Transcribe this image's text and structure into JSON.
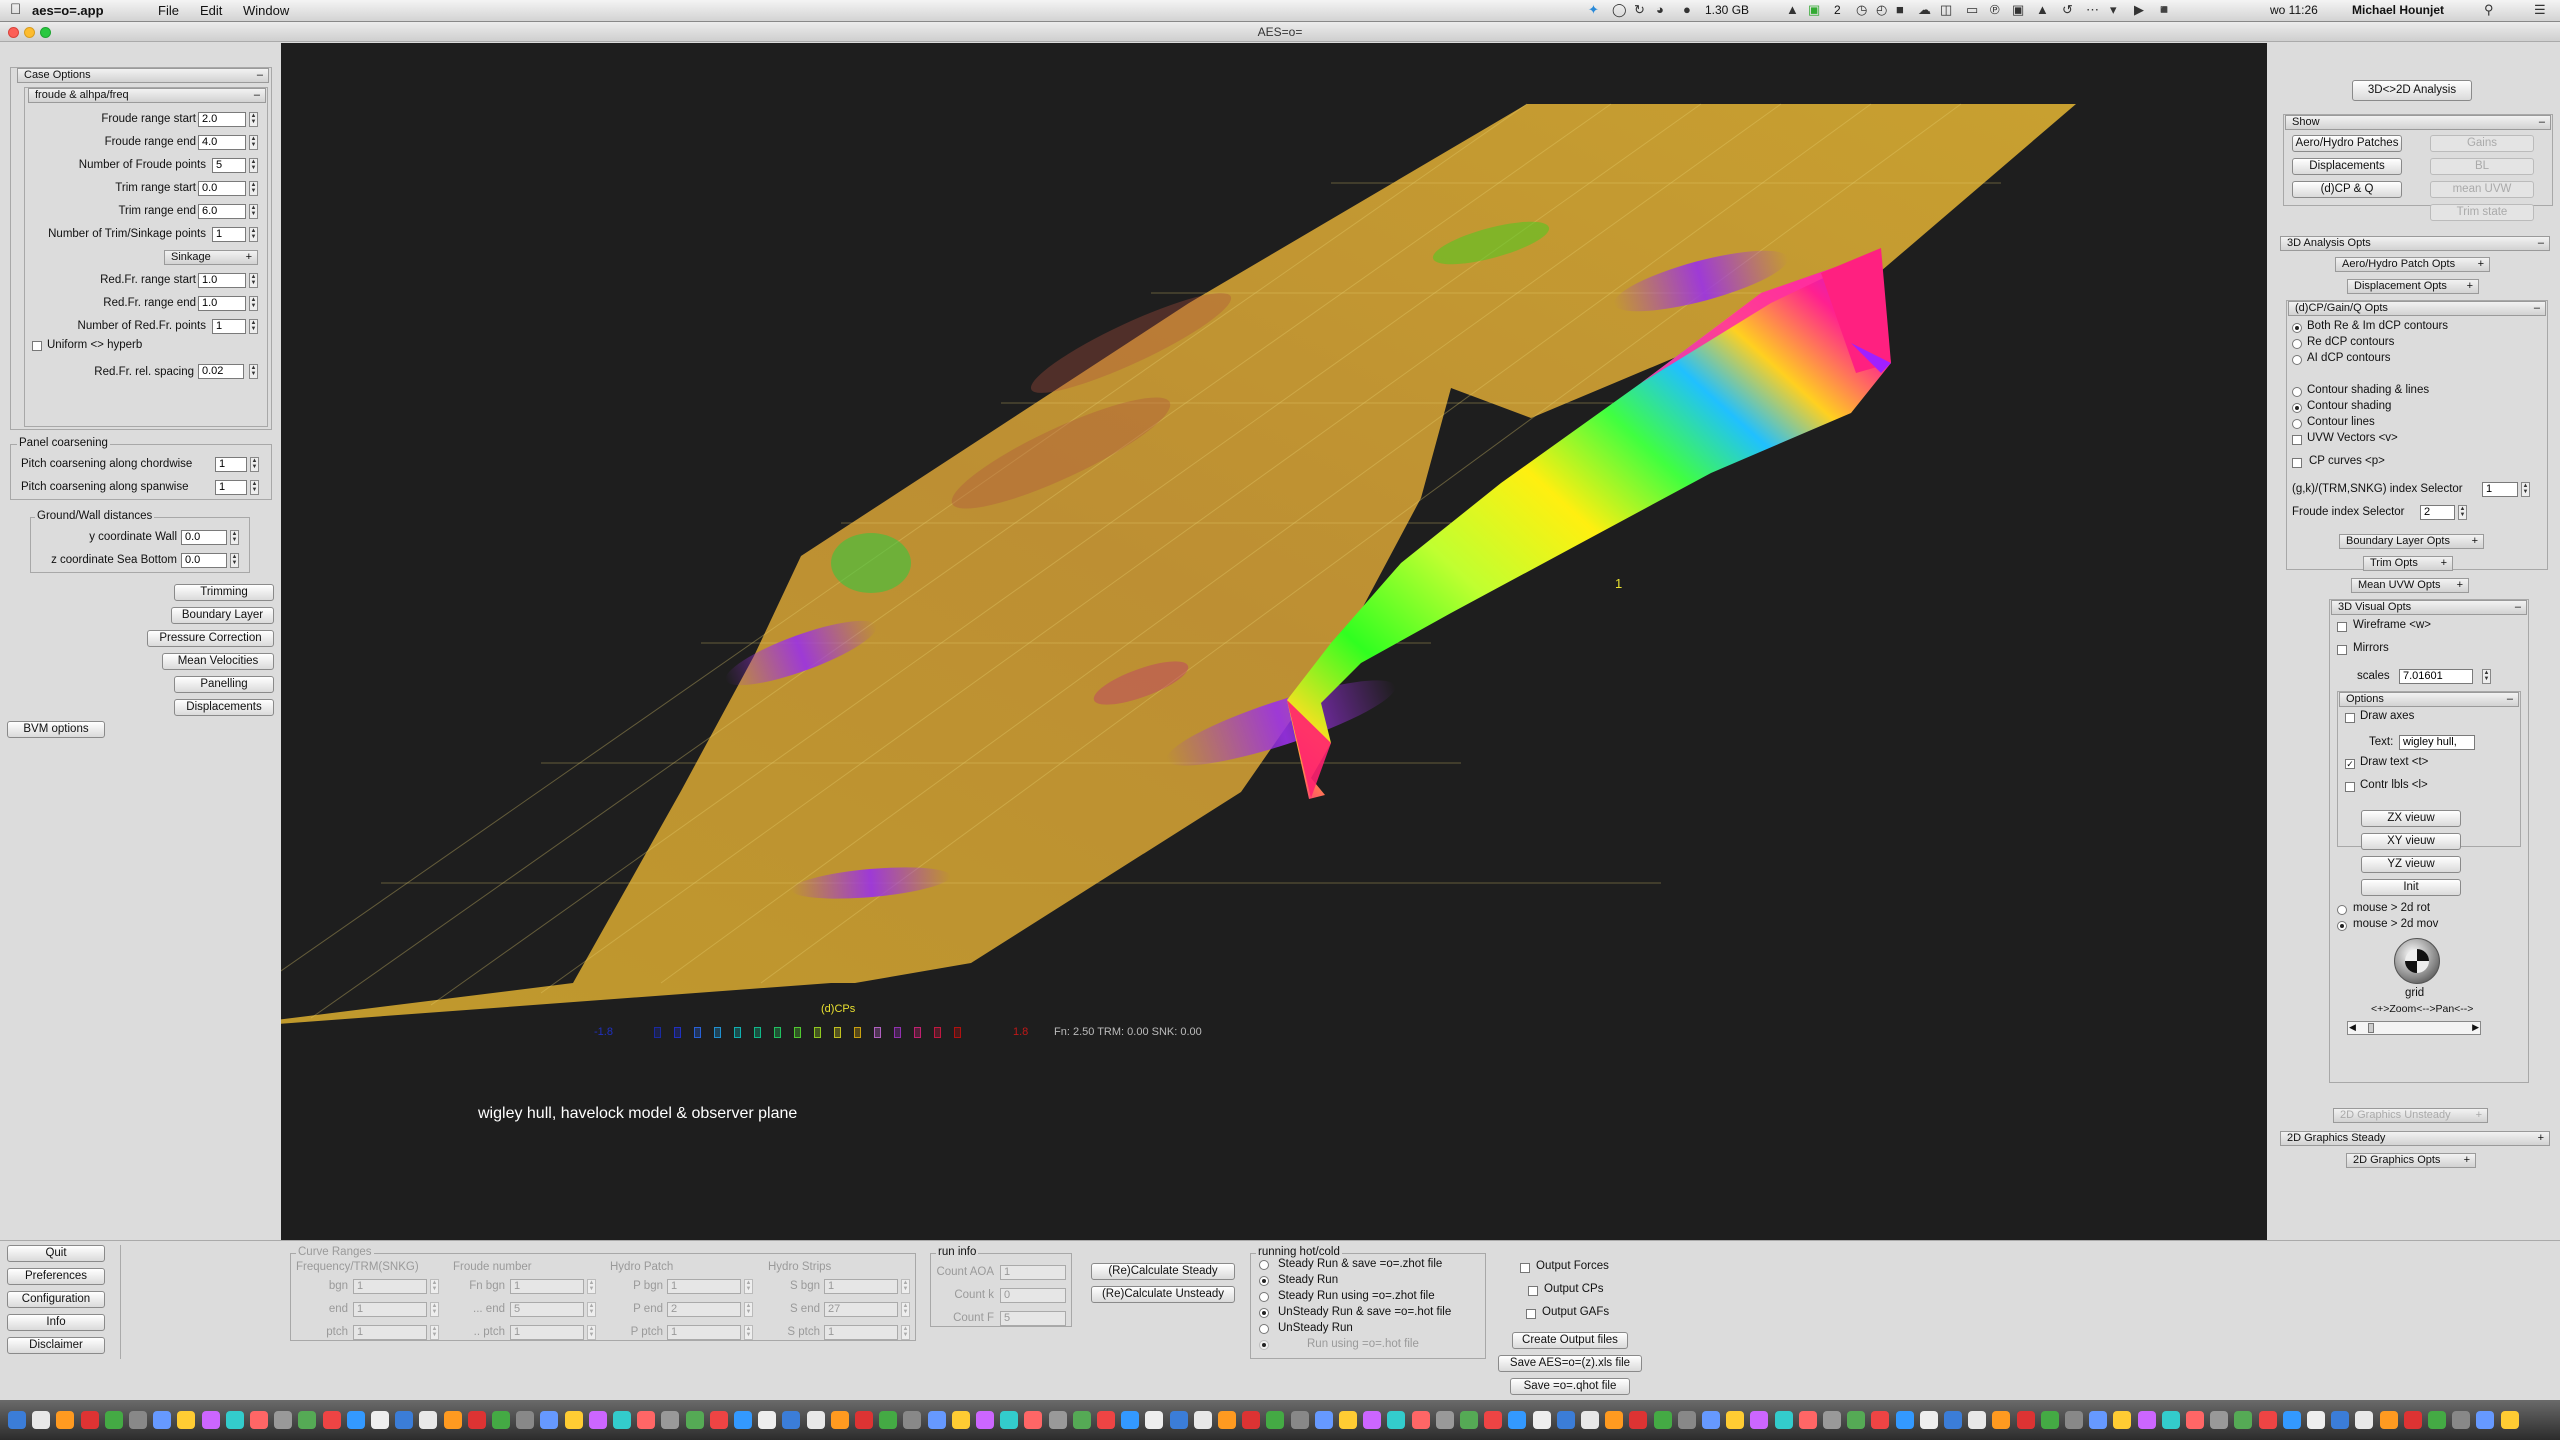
{
  "menubar": {
    "app_name": "aes=o=.app",
    "menus": [
      "File",
      "Edit",
      "Window"
    ],
    "status": {
      "memory": "1.30 GB",
      "spaces": "2",
      "clock": "wo 11:26",
      "user": "Michael Hounjet"
    }
  },
  "window": {
    "title": "AES=o="
  },
  "left_panel": {
    "case_options": {
      "title": "Case Options",
      "froude_group": {
        "title": "froude & alhpa/freq",
        "fields": [
          {
            "label": "Froude range start",
            "value": "2.0"
          },
          {
            "label": "Froude range end",
            "value": "4.0"
          },
          {
            "label": "Number of Froude points",
            "value": "5"
          },
          {
            "label": "Trim range start",
            "value": "0.0"
          },
          {
            "label": "Trim range end",
            "value": "6.0"
          },
          {
            "label": "Number of Trim/Sinkage points",
            "value": "1"
          }
        ]
      },
      "sinkage_label": "Sinkage",
      "redfr_fields": [
        {
          "label": "Red.Fr. range start",
          "value": "1.0"
        },
        {
          "label": "Red.Fr. range end",
          "value": "1.0"
        },
        {
          "label": "Number of Red.Fr. points",
          "value": "1"
        }
      ],
      "uniform_label": "Uniform <> hyperb",
      "spacing": {
        "label": "Red.Fr. rel. spacing",
        "value": "0.02"
      }
    },
    "panel_coarsening": {
      "title": "Panel coarsening",
      "fields": [
        {
          "label": "Pitch coarsening along chordwise",
          "value": "1"
        },
        {
          "label": "Pitch coarsening along  spanwise",
          "value": "1"
        }
      ]
    },
    "ground_wall": {
      "title": "Ground/Wall distances",
      "fields": [
        {
          "label": "y coordinate Wall",
          "value": "0.0"
        },
        {
          "label": "z coordinate Sea Bottom",
          "value": "0.0"
        }
      ]
    },
    "buttons": [
      "Trimming",
      "Boundary Layer",
      "Pressure Correction",
      "Mean Velocities",
      "Panelling",
      "Displacements"
    ],
    "bvm_button": "BVM options"
  },
  "viewport": {
    "legend_title": "(d)CPs",
    "legend_min": "-1.8",
    "legend_max": "1.8",
    "legend_colors": [
      "#1a2aa0",
      "#2030c0",
      "#2860d8",
      "#2090d0",
      "#10b0b0",
      "#10b888",
      "#20c060",
      "#50c830",
      "#90c820",
      "#c0c020",
      "#c8a010",
      "#b060c0",
      "#9030b0",
      "#c02070",
      "#c01840",
      "#b01010"
    ],
    "status": "Fn: 2.50 TRM:   0.00 SNK:   0.00",
    "caption": "wigley hull, havelock model & observer plane",
    "marker_label": "1"
  },
  "right_panel": {
    "analysis_toggle": "3D<>2D Analysis",
    "show": {
      "title": "Show",
      "left_buttons": [
        "Aero/Hydro Patches",
        "Displacements",
        "(d)CP & Q"
      ],
      "right_buttons": [
        "Gains",
        "BL",
        "mean UVW",
        "Trim state"
      ]
    },
    "analysis_opts": {
      "title": "3D Analysis Opts",
      "patch_opts": "Aero/Hydro Patch Opts",
      "displacement_opts": "Displacement  Opts",
      "cp_group": {
        "title": "(d)CP/Gain/Q  Opts",
        "radios_a": [
          {
            "label": "Both Re & Im dCP contours",
            "selected": true
          },
          {
            "label": "Re dCP contours",
            "selected": false
          },
          {
            "label": "AI dCP contours",
            "selected": false
          }
        ],
        "radios_b": [
          {
            "label": "Contour shading & lines",
            "selected": false
          },
          {
            "label": "Contour shading",
            "selected": true
          },
          {
            "label": "Contour lines",
            "selected": false
          }
        ],
        "uvw_label": "UVW Vectors <v>",
        "cp_curves_label": "CP  curves  <p>",
        "index_selector": {
          "label": "(g,k)/(TRM,SNKG) index Selector",
          "value": "1"
        },
        "froude_selector": {
          "label": "Froude index Selector",
          "value": "2"
        }
      },
      "bl_opts": "Boundary Layer Opts",
      "trim_opts": "Trim  Opts",
      "uvw_opts": "Mean UVW Opts"
    },
    "visual_opts": {
      "title": "3D Visual Opts",
      "wireframe": "Wireframe <w>",
      "mirrors": "Mirrors",
      "scales": {
        "label": "scales",
        "value": "7.01601"
      },
      "options": {
        "title": "Options",
        "draw_axes": "Draw axes",
        "text": {
          "label": "Text:",
          "value": "wigley hull,"
        },
        "draw_text": "Draw  text <t>",
        "contr_lbls": "Contr lbls <l>"
      },
      "view_buttons": [
        "ZX vieuw",
        "XY vieuw",
        "YZ vieuw",
        "Init"
      ],
      "mouse_radios": [
        {
          "label": "mouse > 2d rot",
          "selected": false
        },
        {
          "label": "mouse > 2d mov",
          "selected": true
        }
      ],
      "grid_label": "grid",
      "zoom_label": "<+>Zoom<-->Pan<-->"
    },
    "graphics": {
      "unsteady": "2D Graphics Unsteady",
      "steady": "2D Graphics Steady",
      "opts": "2D Graphics Opts"
    }
  },
  "bottom": {
    "side_buttons": [
      "Quit",
      "Preferences",
      "Configuration",
      "Info",
      "Disclaimer"
    ],
    "curve_ranges": {
      "title": "Curve Ranges",
      "columns": [
        {
          "header": "Frequency/TRM(SNKG)",
          "rows": [
            {
              "label": "bgn",
              "value": "1"
            },
            {
              "label": "end",
              "value": "1"
            },
            {
              "label": "ptch",
              "value": "1"
            }
          ]
        },
        {
          "header": "Froude number",
          "rows": [
            {
              "label": "Fn bgn",
              "value": "1"
            },
            {
              "label": "... end",
              "value": "5"
            },
            {
              "label": ".. ptch",
              "value": "1"
            }
          ]
        },
        {
          "header": "Hydro Patch",
          "rows": [
            {
              "label": "P bgn",
              "value": "1"
            },
            {
              "label": "P end",
              "value": "2"
            },
            {
              "label": "P ptch",
              "value": "1"
            }
          ]
        },
        {
          "header": "Hydro Strips",
          "rows": [
            {
              "label": "S bgn",
              "value": "1"
            },
            {
              "label": "S end",
              "value": "27"
            },
            {
              "label": "S ptch",
              "value": "1"
            }
          ]
        }
      ]
    },
    "run_info": {
      "title": "run info",
      "rows": [
        {
          "label": "Count AOA",
          "value": "1"
        },
        {
          "label": "Count k",
          "value": "0"
        },
        {
          "label": "Count F",
          "value": "5"
        }
      ]
    },
    "calc_buttons": [
      "(Re)Calculate Steady",
      "(Re)Calculate Unsteady"
    ],
    "running": {
      "title": "running hot/cold",
      "options": [
        {
          "label": "Steady Run & save =o=.zhot file",
          "selected": false,
          "disabled": false
        },
        {
          "label": "Steady Run",
          "selected": true,
          "disabled": false
        },
        {
          "label": "Steady Run  using =o=.zhot file",
          "selected": false,
          "disabled": false
        },
        {
          "label": "UnSteady Run & save =o=.hot file",
          "selected": true,
          "disabled": false
        },
        {
          "label": "UnSteady Run",
          "selected": false,
          "disabled": false
        },
        {
          "label": "Run  using =o=.hot file",
          "selected": true,
          "disabled": true
        }
      ]
    },
    "outputs": {
      "checks": [
        "Output Forces",
        "Output CPs",
        "Output GAFs"
      ],
      "buttons": [
        "Create Output files",
        "Save AES=o=(z).xls file",
        "Save =o=.qhot file"
      ]
    }
  }
}
